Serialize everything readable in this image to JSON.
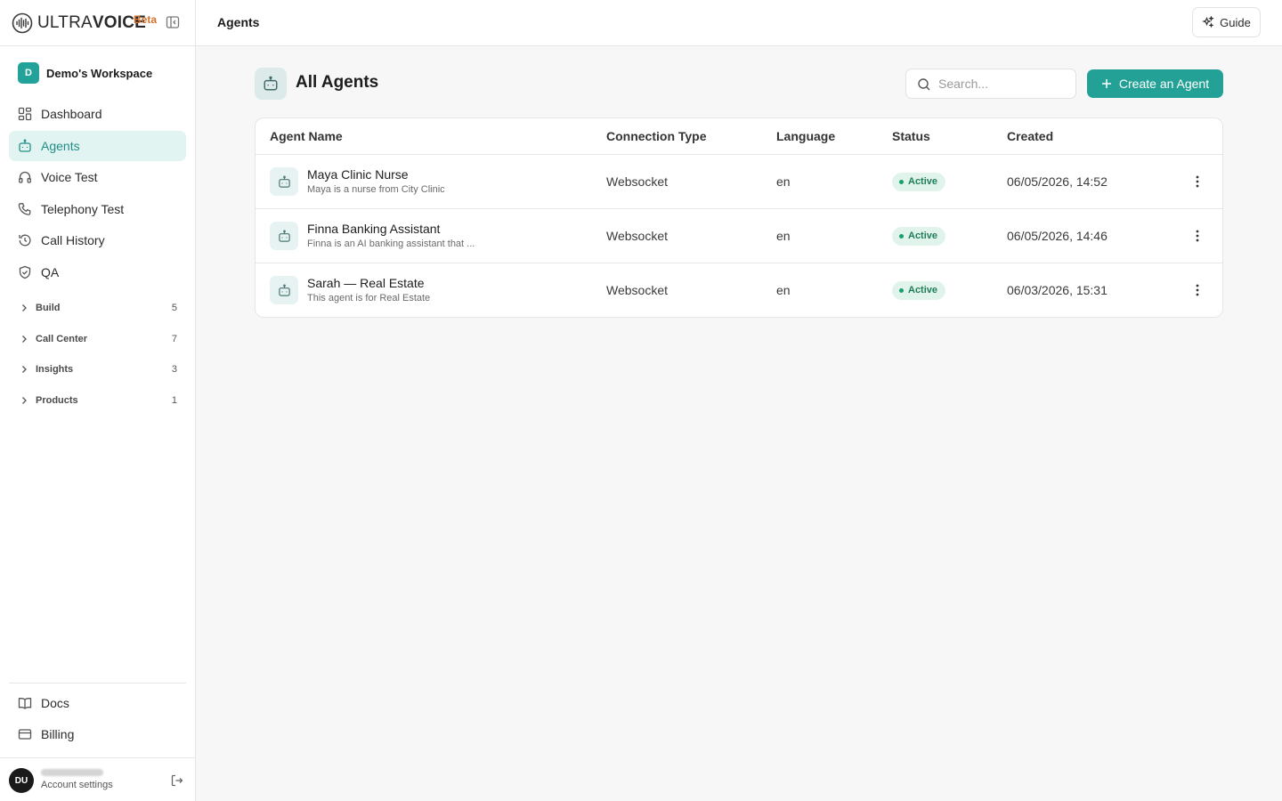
{
  "brand": {
    "name_light": "ULTRA",
    "name_bold": "VOICE",
    "beta": "Beta"
  },
  "workspace": {
    "initial": "D",
    "name": "Demo's Workspace"
  },
  "nav": {
    "items": [
      {
        "label": "Dashboard",
        "icon": "grid-icon"
      },
      {
        "label": "Agents",
        "icon": "bot-icon",
        "active": true
      },
      {
        "label": "Voice Test",
        "icon": "headphones-icon"
      },
      {
        "label": "Telephony Test",
        "icon": "phone-icon"
      },
      {
        "label": "Call History",
        "icon": "history-icon"
      },
      {
        "label": "QA",
        "icon": "shield-check-icon"
      }
    ],
    "groups": [
      {
        "label": "Build",
        "count": "5"
      },
      {
        "label": "Call Center",
        "count": "7"
      },
      {
        "label": "Insights",
        "count": "3"
      },
      {
        "label": "Products",
        "count": "1"
      }
    ],
    "footer": [
      {
        "label": "Docs",
        "icon": "book-icon"
      },
      {
        "label": "Billing",
        "icon": "credit-card-icon"
      }
    ]
  },
  "account": {
    "initials": "DU",
    "settings_label": "Account settings"
  },
  "topbar": {
    "title": "Agents",
    "guide_label": "Guide"
  },
  "main": {
    "title": "All Agents",
    "search_placeholder": "Search...",
    "create_label": "Create an Agent",
    "table": {
      "headers": [
        "Agent Name",
        "Connection Type",
        "Language",
        "Status",
        "Created"
      ],
      "rows": [
        {
          "name": "Maya Clinic Nurse",
          "description": "Maya is a nurse from City Clinic",
          "connection": "Websocket",
          "language": "en",
          "status": "Active",
          "created": "06/05/2026, 14:52"
        },
        {
          "name": "Finna Banking Assistant",
          "description": "Finna is an AI banking assistant that ...",
          "connection": "Websocket",
          "language": "en",
          "status": "Active",
          "created": "06/05/2026, 14:46"
        },
        {
          "name": "Sarah — Real Estate",
          "description": "This agent is for Real Estate",
          "connection": "Websocket",
          "language": "en",
          "status": "Active",
          "created": "06/03/2026, 15:31"
        }
      ]
    }
  },
  "colors": {
    "accent": "#24a196",
    "active_bg": "#e2f4f2",
    "status_green": "#16a06a"
  }
}
